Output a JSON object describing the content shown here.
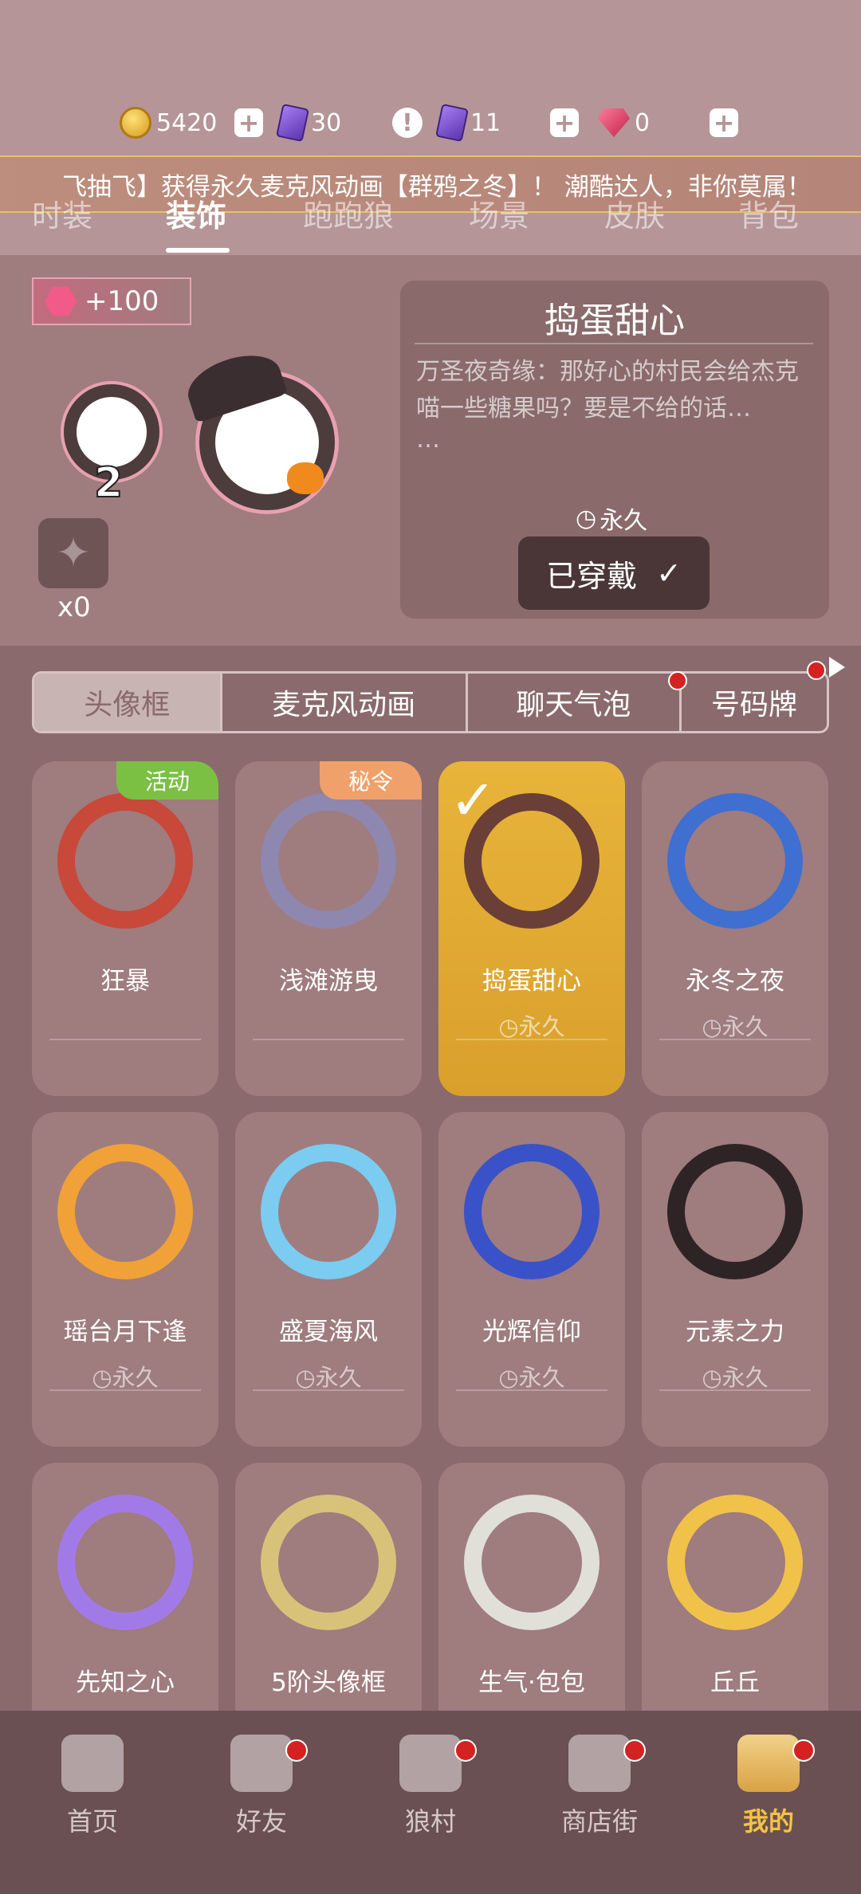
{
  "currencies": {
    "coins": "5420",
    "tickets": "30",
    "cards": "11",
    "gems": "0"
  },
  "marquee": "飞抽飞】获得永久麦克风动画【群鸦之冬】！ 潮酷达人，非你莫属！",
  "tabs": [
    "时装",
    "装饰",
    "跑跑狼",
    "场景",
    "皮肤",
    "背包"
  ],
  "preview": {
    "bonus": "+100",
    "level": "2",
    "puzzle_count": "x0",
    "title": "捣蛋甜心",
    "description": "万圣夜奇缘：那好心的村民会给杰克喵一些糖果吗？要是不给的话…",
    "ellipsis": "…",
    "duration": "永久",
    "wear_button": "已穿戴",
    "check": "✓"
  },
  "sub_tabs": [
    "头像框",
    "麦克风动画",
    "聊天气泡",
    "号码牌"
  ],
  "items": [
    {
      "name": "狂暴",
      "time": "",
      "tag": "活动",
      "color": "#c8483a"
    },
    {
      "name": "浅滩游曳",
      "time": "",
      "tag": "秘令",
      "color": "#8e88b0"
    },
    {
      "name": "捣蛋甜心",
      "time": "永久",
      "tag": "",
      "color": "#6a3f38"
    },
    {
      "name": "永冬之夜",
      "time": "永久",
      "tag": "",
      "color": "#3f6fd0"
    },
    {
      "name": "瑶台月下逢",
      "time": "永久",
      "tag": "",
      "color": "#f0a238"
    },
    {
      "name": "盛夏海风",
      "time": "永久",
      "tag": "",
      "color": "#7ccbf0"
    },
    {
      "name": "光辉信仰",
      "time": "永久",
      "tag": "",
      "color": "#3a52c8"
    },
    {
      "name": "元素之力",
      "time": "永久",
      "tag": "",
      "color": "#2e2426"
    },
    {
      "name": "先知之心",
      "time": "",
      "tag": "",
      "color": "#a27ae8"
    },
    {
      "name": "5阶头像框",
      "time": "",
      "tag": "",
      "color": "#d8c27a"
    },
    {
      "name": "生气·包包",
      "time": "",
      "tag": "",
      "color": "#e0e0d8"
    },
    {
      "name": "丘丘",
      "time": "",
      "tag": "",
      "color": "#f1c24a"
    }
  ],
  "tag_colors": {
    "活动": "#7bc043",
    "秘令": "#f0a06a"
  },
  "nav": [
    "首页",
    "好友",
    "狼村",
    "商店街",
    "我的"
  ]
}
